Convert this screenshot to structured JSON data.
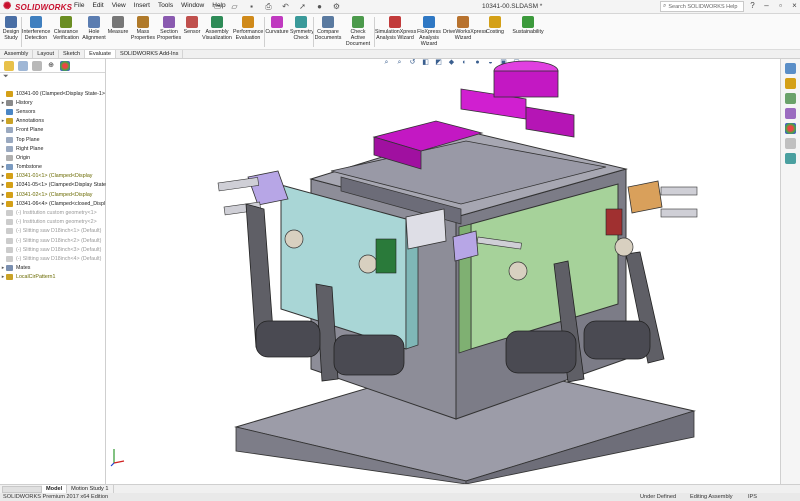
{
  "app": {
    "brand": "SOLIDWORKS",
    "document_title": "10341-00.SLDASM *"
  },
  "menu": [
    "File",
    "Edit",
    "View",
    "Insert",
    "Tools",
    "Window",
    "Help"
  ],
  "quick_access_icons": [
    "new-icon",
    "open-icon",
    "save-icon",
    "print-icon",
    "undo-icon",
    "select-icon",
    "rebuild-icon",
    "options-icon"
  ],
  "help_search": {
    "placeholder": "Search SOLIDWORKS Help"
  },
  "window_controls": [
    "help-icon",
    "minimize-icon",
    "restore-icon",
    "close-icon"
  ],
  "ribbon": [
    {
      "label": "Design Study",
      "icon": "design-study-icon",
      "color": "#4a6fa5"
    },
    {
      "label": "Interference Detection",
      "icon": "interference-icon",
      "color": "#3f7fbf"
    },
    {
      "label": "Clearance Verification",
      "icon": "clearance-icon",
      "color": "#6b8e23"
    },
    {
      "label": "Hole Alignment",
      "icon": "hole-alignment-icon",
      "color": "#5b7db1"
    },
    {
      "label": "Measure",
      "icon": "measure-icon",
      "color": "#777777"
    },
    {
      "label": "Mass Properties",
      "icon": "mass-properties-icon",
      "color": "#b07a2a"
    },
    {
      "label": "Section Properties",
      "icon": "section-properties-icon",
      "color": "#8a5ab0"
    },
    {
      "label": "Sensor",
      "icon": "sensor-icon",
      "color": "#c0504d"
    },
    {
      "label": "Assembly Visualization",
      "icon": "assembly-visualization-icon",
      "color": "#2e8b57"
    },
    {
      "label": "Performance Evaluation",
      "icon": "performance-icon",
      "color": "#d08a1a"
    },
    {
      "label": "Curvature",
      "icon": "curvature-icon",
      "color": "#c03ac0"
    },
    {
      "label": "Symmetry Check",
      "icon": "symmetry-icon",
      "color": "#3a9a9a"
    },
    {
      "label": "Compare Documents",
      "icon": "compare-icon",
      "color": "#5a7aa0"
    },
    {
      "label": "Check Active Document",
      "icon": "check-document-icon",
      "color": "#4c9a4c"
    },
    {
      "label": "SimulationXpress Analysis Wizard",
      "icon": "simulationxpress-icon",
      "color": "#c23b3b"
    },
    {
      "label": "FloXpress Analysis Wizard",
      "icon": "floxpress-icon",
      "color": "#2f78c4"
    },
    {
      "label": "DriveWorksXpress Wizard",
      "icon": "driveworksxpress-icon",
      "color": "#b8732f"
    },
    {
      "label": "Costing",
      "icon": "costing-icon",
      "color": "#d4a017"
    },
    {
      "label": "Sustainability",
      "icon": "sustainability-icon",
      "color": "#3c9a3c"
    }
  ],
  "command_tabs": [
    "Assembly",
    "Layout",
    "Sketch",
    "Evaluate",
    "SOLIDWORKS Add-Ins"
  ],
  "active_command_tab": "Evaluate",
  "feature_tree": [
    {
      "label": "10341-00  (Clamped<Display State-1>",
      "state": "normal",
      "arrow": "",
      "icon_color": "#d4a017"
    },
    {
      "label": "History",
      "state": "normal",
      "arrow": "▸",
      "icon_color": "#8a8a8a"
    },
    {
      "label": "Sensors",
      "state": "normal",
      "arrow": "",
      "icon_color": "#4a86c5"
    },
    {
      "label": "Annotations",
      "state": "normal",
      "arrow": "▸",
      "icon_color": "#c9a227"
    },
    {
      "label": "Front Plane",
      "state": "normal",
      "arrow": "",
      "icon_color": "#9aa9c0"
    },
    {
      "label": "Top Plane",
      "state": "normal",
      "arrow": "",
      "icon_color": "#9aa9c0"
    },
    {
      "label": "Right Plane",
      "state": "normal",
      "arrow": "",
      "icon_color": "#9aa9c0"
    },
    {
      "label": "Origin",
      "state": "normal",
      "arrow": "",
      "icon_color": "#b0b0b0"
    },
    {
      "label": "Tombstone",
      "state": "normal",
      "arrow": "▸",
      "icon_color": "#7a9ac0"
    },
    {
      "label": "10341-01<1> (Clamped<Display",
      "state": "warn",
      "arrow": "▸",
      "icon_color": "#d4a017"
    },
    {
      "label": "10341-05<1> (Clamped<Display State",
      "state": "normal",
      "arrow": "▸",
      "icon_color": "#d4a017"
    },
    {
      "label": "10341-02<1> (Clamped<Display",
      "state": "warn",
      "arrow": "▸",
      "icon_color": "#d4a017"
    },
    {
      "label": "10341-06<4> (Clamped<closed_Displ",
      "state": "normal",
      "arrow": "▸",
      "icon_color": "#d4a017"
    },
    {
      "label": "(-) Institution custom geometry<1>",
      "state": "sup",
      "arrow": "",
      "icon_color": "#cccccc"
    },
    {
      "label": "(-) Institution custom geometry<2>",
      "state": "sup",
      "arrow": "",
      "icon_color": "#cccccc"
    },
    {
      "label": "(-) Slitting saw D18inch<1> (Default)",
      "state": "sup",
      "arrow": "",
      "icon_color": "#cccccc"
    },
    {
      "label": "(-) Slitting saw D18inch<2> (Default)",
      "state": "sup",
      "arrow": "",
      "icon_color": "#cccccc"
    },
    {
      "label": "(-) Slitting saw D18inch<3> (Default)",
      "state": "sup",
      "arrow": "",
      "icon_color": "#cccccc"
    },
    {
      "label": "(-) Slitting saw D18inch<4> (Default)",
      "state": "sup",
      "arrow": "",
      "icon_color": "#cccccc"
    },
    {
      "label": "Mates",
      "state": "normal",
      "arrow": "▸",
      "icon_color": "#7a8fb0"
    },
    {
      "label": "LocalCirPattern1",
      "state": "warn",
      "arrow": "▸",
      "icon_color": "#c9a227"
    }
  ],
  "feature_tabs": [
    "feature-manager-icon",
    "property-manager-icon",
    "configuration-manager-icon",
    "dimxpert-icon",
    "display-manager-icon"
  ],
  "heads_up_icons": [
    "zoom-to-fit-icon",
    "zoom-area-icon",
    "previous-view-icon",
    "section-view-icon",
    "view-orientation-icon",
    "display-style-icon",
    "hide-show-icon",
    "edit-appearance-icon",
    "apply-scene-icon",
    "view-settings-icon",
    "display-pane-icon"
  ],
  "model_tabs": [
    "Model",
    "Motion Study 1"
  ],
  "active_model_tab": "Model",
  "status": {
    "edition": "SOLIDWORKS Premium 2017 x64 Edition",
    "state": "Under Defined",
    "mode": "Editing Assembly",
    "units": "IPS"
  },
  "colors": {
    "brand": "#c8102e",
    "fixture_cyan": "#a9d6d6",
    "fixture_green": "#a6d29a",
    "clamp_magenta": "#d01fd0",
    "base_gray": "#9a9aa6",
    "clamp_purple": "#b7a6e6",
    "clamp_orange": "#d9a05b"
  }
}
